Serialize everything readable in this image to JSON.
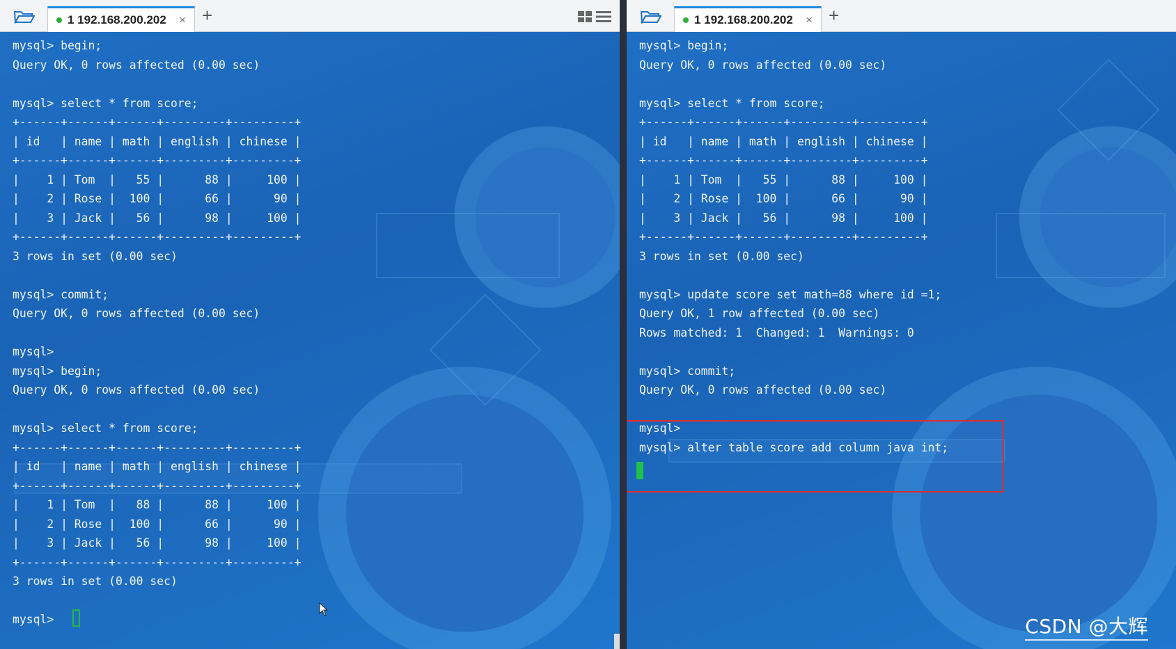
{
  "left_pane": {
    "tab": {
      "label": "1 192.168.200.202",
      "close": "×"
    },
    "add_tab": "+",
    "lines": [
      "mysql> begin;",
      "Query OK, 0 rows affected (0.00 sec)",
      "",
      "mysql> select * from score;",
      "+------+------+------+---------+---------+",
      "| id   | name | math | english | chinese |",
      "+------+------+------+---------+---------+",
      "|    1 | Tom  |   55 |      88 |     100 |",
      "|    2 | Rose |  100 |      66 |      90 |",
      "|    3 | Jack |   56 |      98 |     100 |",
      "+------+------+------+---------+---------+",
      "3 rows in set (0.00 sec)",
      "",
      "mysql> commit;",
      "Query OK, 0 rows affected (0.00 sec)",
      "",
      "mysql>",
      "mysql> begin;",
      "Query OK, 0 rows affected (0.00 sec)",
      "",
      "mysql> select * from score;",
      "+------+------+------+---------+---------+",
      "| id   | name | math | english | chinese |",
      "+------+------+------+---------+---------+",
      "|    1 | Tom  |   88 |      88 |     100 |",
      "|    2 | Rose |  100 |      66 |      90 |",
      "|    3 | Jack |   56 |      98 |     100 |",
      "+------+------+------+---------+---------+",
      "3 rows in set (0.00 sec)",
      "",
      "mysql>"
    ]
  },
  "right_pane": {
    "tab": {
      "label": "1 192.168.200.202",
      "close": "×"
    },
    "add_tab": "+",
    "lines": [
      "mysql> begin;",
      "Query OK, 0 rows affected (0.00 sec)",
      "",
      "mysql> select * from score;",
      "+------+------+------+---------+---------+",
      "| id   | name | math | english | chinese |",
      "+------+------+------+---------+---------+",
      "|    1 | Tom  |   55 |      88 |     100 |",
      "|    2 | Rose |  100 |      66 |      90 |",
      "|    3 | Jack |   56 |      98 |     100 |",
      "+------+------+------+---------+---------+",
      "3 rows in set (0.00 sec)",
      "",
      "mysql> update score set math=88 where id =1;",
      "Query OK, 1 row affected (0.00 sec)",
      "Rows matched: 1  Changed: 1  Warnings: 0",
      "",
      "mysql> commit;",
      "Query OK, 0 rows affected (0.00 sec)",
      "",
      "mysql>",
      "mysql> alter table score add column java int;"
    ]
  },
  "watermark": "CSDN @大辉",
  "colors": {
    "terminal_bg": "#1d6cc0",
    "terminal_text": "#eef4fb",
    "tab_accent": "#1e88e5",
    "status_dot": "#2fae3a",
    "cursor": "#1ec14a",
    "highlight": "#e12d2d"
  },
  "icons": [
    "folder-icon",
    "plus-icon",
    "close-icon",
    "layout-grid-icon",
    "menu-icon",
    "mouse-pointer-icon"
  ]
}
